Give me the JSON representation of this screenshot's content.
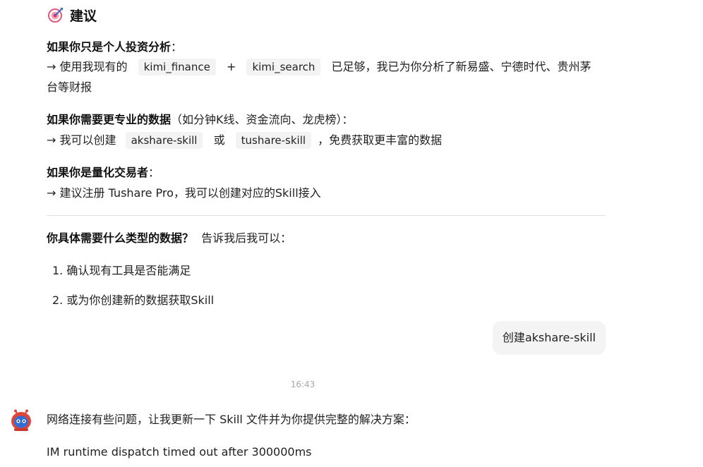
{
  "heading": {
    "title": "建议",
    "icon": "target-icon"
  },
  "section1": {
    "title": "如果你只是个人投资分析",
    "colon": "：",
    "prefix": "→ 使用我现有的",
    "tool1": "kimi_finance",
    "plus": "+",
    "tool2": "kimi_search",
    "suffix": "已足够，我已为你分析了新易盛、宁德时代、贵州茅",
    "suffix2": "台等财报"
  },
  "section2": {
    "title": "如果你需要更专业的数据",
    "note": "（如分钟K线、资金流向、龙虎榜）：",
    "prefix": "→ 我可以创建",
    "tool1": "akshare-skill",
    "or": "或",
    "tool2": "tushare-skill",
    "suffix": "，免费获取更丰富的数据"
  },
  "section3": {
    "title": "如果你是量化交易者",
    "colon": "：",
    "body": "→ 建议注册 Tushare Pro，我可以创建对应的Skill接入"
  },
  "question": {
    "bold": "你具体需要什么类型的数据？",
    "rest": "告诉我后我可以："
  },
  "options": [
    {
      "num": "1.",
      "text": "确认现有工具是否能满足"
    },
    {
      "num": "2.",
      "text": "或为你创建新的数据获取Skill"
    }
  ],
  "user_message": "创建akshare-skill",
  "timestamp": "16:43",
  "assistant": {
    "avatar": "robot-avatar-icon",
    "line1": "网络连接有些问题，让我更新一下 Skill 文件并为你提供完整的解决方案：",
    "line2": "IM runtime dispatch timed out after 300000ms"
  },
  "colors": {
    "code_bg": "#f3f3f3",
    "bubble_bg": "#f4f4f5",
    "avatar_red": "#e0453a",
    "avatar_blue": "#2f6fd6"
  }
}
